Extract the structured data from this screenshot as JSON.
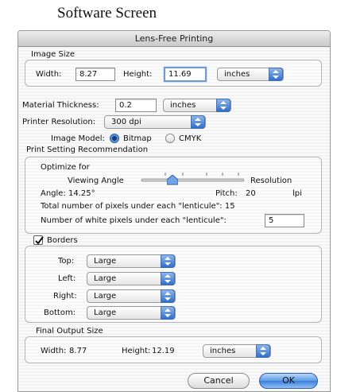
{
  "caption": "Software Screen",
  "window": {
    "title": "Lens-Free Printing"
  },
  "image_size": {
    "heading": "Image Size",
    "width_label": "Width:",
    "width_value": "8.27",
    "height_label": "Height:",
    "height_value": "11.69",
    "unit": "inches"
  },
  "material": {
    "label": "Material Thickness:",
    "value": "0.2",
    "unit": "inches"
  },
  "printer": {
    "label": "Printer Resolution:",
    "value": "300 dpi"
  },
  "image_model": {
    "label": "Image Model:",
    "option1": "Bitmap",
    "option2": "CMYK",
    "selected": "Bitmap"
  },
  "recommendation": {
    "heading": "Print Setting Recommendation",
    "optimize_label": "Optimize for",
    "left_label": "Viewing Angle",
    "right_label": "Resolution",
    "slider_value": 0.3,
    "angle": "Angle: 14.25°",
    "pitch_label": "Pitch:",
    "pitch_value": "20",
    "pitch_unit": "lpi",
    "total_pixels": "Total number of pixels under each \"lenticule\":  15",
    "white_pixels_label": "Number of white pixels under each \"lenticule\":",
    "white_pixels_value": "5"
  },
  "borders": {
    "label": "Borders",
    "checked": true,
    "top_label": "Top:",
    "top_value": "Large",
    "left_label": "Left:",
    "left_value": "Large",
    "right_label": "Right:",
    "right_value": "Large",
    "bottom_label": "Bottom:",
    "bottom_value": "Large"
  },
  "final_output": {
    "heading": "Final Output Size",
    "width_label": "Width:",
    "width_value": "8.77",
    "height_label": "Height:",
    "height_value": "12.19",
    "unit": "inches"
  },
  "buttons": {
    "cancel": "Cancel",
    "ok": "OK"
  },
  "colors": {
    "accent": "#3a80dc",
    "focus": "#6b98d6"
  }
}
